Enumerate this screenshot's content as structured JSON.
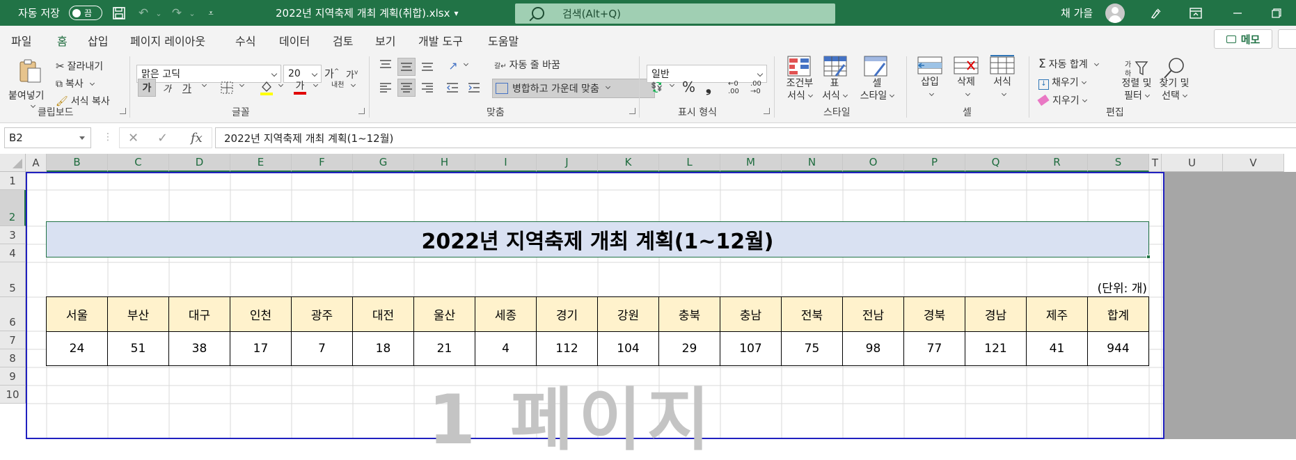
{
  "titlebar": {
    "autosave_label": "자동 저장",
    "autosave_state": "끔",
    "filename": "2022년 지역축제 개최 계획(취합).xlsx",
    "search_placeholder": "검색(Alt+Q)",
    "username": "채 가을"
  },
  "menu": {
    "tabs": [
      "파일",
      "홈",
      "삽입",
      "페이지 레이아웃",
      "수식",
      "데이터",
      "검토",
      "보기",
      "개발 도구",
      "도움말"
    ],
    "active_tab": "홈",
    "memo_label": "메모"
  },
  "ribbon": {
    "clipboard": {
      "paste": "붙여넣기",
      "cut": "잘라내기",
      "copy": "복사",
      "format_painter": "서식 복사",
      "group": "클립보드"
    },
    "font": {
      "name": "맑은 고딕",
      "size": "20",
      "bold": "가",
      "italic": "가",
      "underline": "가",
      "phonetic": "내천",
      "group": "글꼴"
    },
    "alignment": {
      "wrap": "자동 줄 바꿈",
      "merge": "병합하고 가운데 맞춤",
      "group": "맞춤"
    },
    "number": {
      "format": "일반",
      "group": "표시 형식"
    },
    "styles": {
      "conditional": "조건부\n서식",
      "table": "표\n서식",
      "cell_style": "셀\n스타일",
      "group": "스타일"
    },
    "cells": {
      "insert": "삽입",
      "delete": "삭제",
      "format": "서식",
      "group": "셀"
    },
    "editing": {
      "autosum": "자동 합계",
      "fill": "채우기",
      "clear": "지우기",
      "sort": "정렬 및\n필터",
      "find": "찾기 및\n선택",
      "group": "편집"
    }
  },
  "formula_bar": {
    "name_box": "B2",
    "formula": "2022년 지역축제 개최 계획(1~12월)"
  },
  "sheet": {
    "columns": [
      "A",
      "B",
      "C",
      "D",
      "E",
      "F",
      "G",
      "H",
      "I",
      "J",
      "K",
      "L",
      "M",
      "N",
      "O",
      "P",
      "Q",
      "R",
      "S",
      "T",
      "U",
      "V"
    ],
    "rows": [
      "1",
      "2",
      "3",
      "4",
      "5",
      "6",
      "7",
      "8",
      "9",
      "10"
    ],
    "title": "2022년 지역축제 개최 계획(1~12월)",
    "unit": "(단위: 개)",
    "headers": [
      "서울",
      "부산",
      "대구",
      "인천",
      "광주",
      "대전",
      "울산",
      "세종",
      "경기",
      "강원",
      "충북",
      "충남",
      "전북",
      "전남",
      "경북",
      "경남",
      "제주",
      "합계"
    ],
    "values": [
      "24",
      "51",
      "38",
      "17",
      "7",
      "18",
      "21",
      "4",
      "112",
      "104",
      "29",
      "107",
      "75",
      "98",
      "77",
      "121",
      "41",
      "944"
    ],
    "page_watermark": "1 페이지"
  }
}
